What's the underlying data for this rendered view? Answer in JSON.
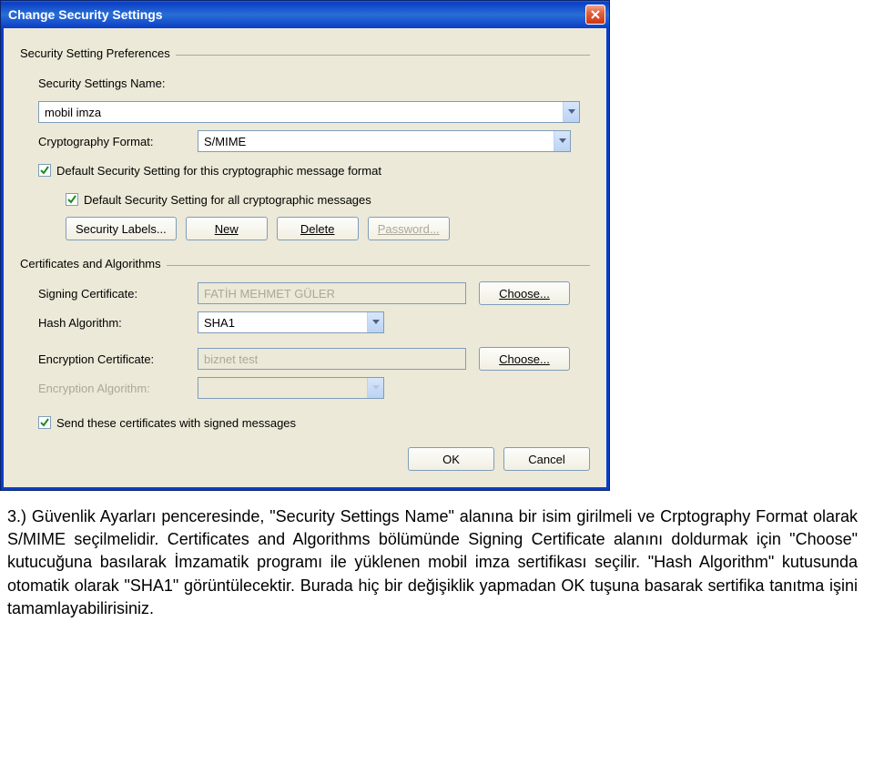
{
  "titlebar": {
    "title": "Change Security Settings"
  },
  "group_prefs": {
    "legend": "Security Setting Preferences",
    "name_label": "Security Settings Name:",
    "name_value": "mobil imza",
    "format_label": "Cryptography Format:",
    "format_value": "S/MIME",
    "cb_default_format": "Default Security Setting for this cryptographic message format",
    "cb_default_all": "Default Security Setting for all cryptographic messages",
    "btn_labels": "Security Labels...",
    "btn_new": "New",
    "btn_delete": "Delete",
    "btn_password": "Password..."
  },
  "group_certs": {
    "legend": "Certificates and Algorithms",
    "signing_label": "Signing Certificate:",
    "signing_value": "FATİH MEHMET GÜLER",
    "hash_label": "Hash Algorithm:",
    "hash_value": "SHA1",
    "enc_cert_label": "Encryption Certificate:",
    "enc_cert_value": "biznet test",
    "enc_alg_label": "Encryption Algorithm:",
    "choose_label": "Choose...",
    "cb_send": "Send these certificates with signed messages"
  },
  "buttons": {
    "ok": "OK",
    "cancel": "Cancel"
  },
  "doc": {
    "text": "3.) Güvenlik Ayarları penceresinde, \"Security Settings Name\" alanına bir isim girilmeli ve Crptography Format olarak S/MIME seçilmelidir. Certificates and Algorithms bölümünde Signing Certificate alanını doldurmak için \"Choose\" kutucuğuna basılarak İmzamatik programı ile  yüklenen mobil imza sertifikası seçilir. \"Hash Algorithm\" kutusunda otomatik olarak \"SHA1\" görüntülecektir. Burada hiç bir değişiklik yapmadan OK tuşuna basarak sertifika tanıtma işini tamamlayabilirisiniz."
  }
}
